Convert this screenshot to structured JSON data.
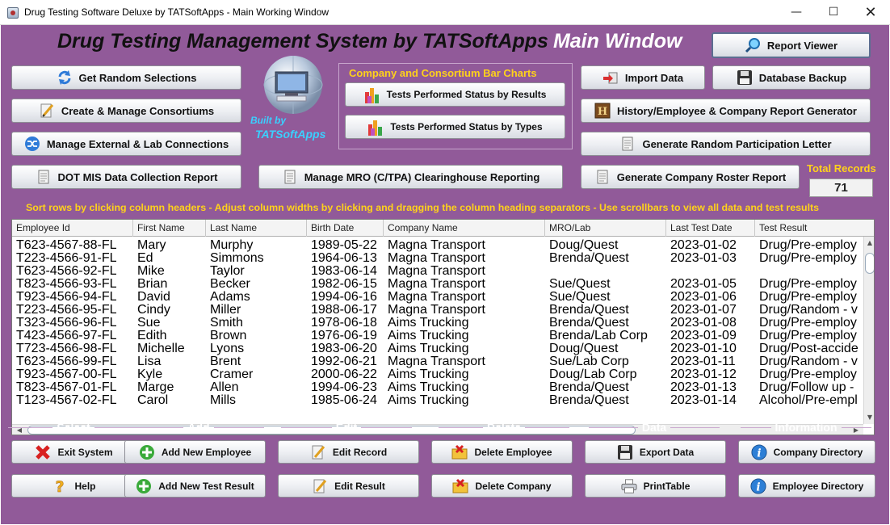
{
  "window": {
    "title": "Drug Testing Software Deluxe by TATSoftApps - Main Working Window",
    "minimize_glyph": "—",
    "maximize_glyph": "☐",
    "close_glyph": "✕"
  },
  "header": {
    "title": "Drug Testing Management System by TATSoftApps",
    "subtitle": "Main Window"
  },
  "branding": {
    "built_by": "Built by",
    "company": "TATSoftApps"
  },
  "buttons": {
    "report_viewer": "Report Viewer",
    "get_random_selections": "Get Random Selections",
    "create_manage_consortiums": "Create & Manage Consortiums",
    "manage_external_lab": "Manage External & Lab Connections",
    "dot_mis_report": "DOT MIS Data Collection Report",
    "manage_mro": "Manage MRO (C/TPA) Clearinghouse Reporting",
    "import_data": "Import Data",
    "database_backup": "Database Backup",
    "history_report": "History/Employee & Company Report Generator",
    "random_letter": "Generate Random Participation Letter",
    "company_roster": "Generate Company Roster Report"
  },
  "bar_charts": {
    "title": "Company and Consortium Bar Charts",
    "by_results": "Tests Performed Status by Results",
    "by_types": "Tests Performed Status by Types"
  },
  "total_records": {
    "label": "Total Records",
    "value": "71"
  },
  "instructions": "Sort rows by clicking column headers - Adjust column widths by clicking and dragging the column heading separators - Use scrollbars to view all data and test results",
  "table": {
    "columns": [
      "Employee Id",
      "First Name",
      "Last Name",
      "Birth Date",
      "Company Name",
      "MRO/Lab",
      "Last Test Date",
      "Test Result"
    ],
    "rows": [
      [
        "T623-4567-88-FL",
        "Mary",
        "Murphy",
        "1989-05-22",
        "Magna Transport",
        "Doug/Quest",
        "2023-01-02",
        "Drug/Pre-employ"
      ],
      [
        "T223-4566-91-FL",
        "Ed",
        "Simmons",
        "1964-06-13",
        "Magna Transport",
        "Brenda/Quest",
        "2023-01-03",
        "Drug/Pre-employ"
      ],
      [
        "T623-4566-92-FL",
        "Mike",
        "Taylor",
        "1983-06-14",
        "Magna Transport",
        "",
        "",
        ""
      ],
      [
        "T823-4566-93-FL",
        "Brian",
        "Becker",
        "1982-06-15",
        "Magna Transport",
        "Sue/Quest",
        "2023-01-05",
        "Drug/Pre-employ"
      ],
      [
        "T923-4566-94-FL",
        "David",
        "Adams",
        "1994-06-16",
        "Magna Transport",
        "Sue/Quest",
        "2023-01-06",
        "Drug/Pre-employ"
      ],
      [
        "T223-4566-95-FL",
        "Cindy",
        "Miller",
        "1988-06-17",
        "Magna Transport",
        "Brenda/Quest",
        "2023-01-07",
        "Drug/Random - v"
      ],
      [
        "T323-4566-96-FL",
        "Sue",
        "Smith",
        "1978-06-18",
        "Aims Trucking",
        "Brenda/Quest",
        "2023-01-08",
        "Drug/Pre-employ"
      ],
      [
        "T423-4566-97-FL",
        "Edith",
        "Brown",
        "1976-06-19",
        "Aims Trucking",
        "Brenda/Lab Corp",
        "2023-01-09",
        "Drug/Pre-employ"
      ],
      [
        "T723-4566-98-FL",
        "Michelle",
        "Lyons",
        "1983-06-20",
        "Aims Trucking",
        "Doug/Quest",
        "2023-01-10",
        "Drug/Post-accide"
      ],
      [
        "T623-4566-99-FL",
        "Lisa",
        "Brent",
        "1992-06-21",
        "Magna Transport",
        "Sue/Lab Corp",
        "2023-01-11",
        "Drug/Random - v"
      ],
      [
        "T923-4567-00-FL",
        "Kyle",
        "Cramer",
        "2000-06-22",
        "Aims Trucking",
        "Doug/Lab Corp",
        "2023-01-12",
        "Drug/Pre-employ"
      ],
      [
        "T823-4567-01-FL",
        "Marge",
        "Allen",
        "1994-06-23",
        "Aims Trucking",
        "Brenda/Quest",
        "2023-01-13",
        "Drug/Follow up -"
      ],
      [
        "T123-4567-02-FL",
        "Carol",
        "Mills",
        "1985-06-24",
        "Aims Trucking",
        "Brenda/Quest",
        "2023-01-14",
        "Alcohol/Pre-empl"
      ]
    ]
  },
  "sections": {
    "select": {
      "title": "Select",
      "buttons": [
        "Exit System",
        "Help"
      ]
    },
    "add": {
      "title": "Add",
      "buttons": [
        "Add New Employee",
        "Add New Test Result"
      ]
    },
    "edit": {
      "title": "Edit",
      "buttons": [
        "Edit Record",
        "Edit Result"
      ]
    },
    "delete": {
      "title": "Delete",
      "buttons": [
        "Delete Employee",
        "Delete Company"
      ]
    },
    "data": {
      "title": "Data",
      "buttons": [
        "Export Data",
        "PrintTable"
      ]
    },
    "information": {
      "title": "Information",
      "buttons": [
        "Company Directory",
        "Employee Directory"
      ]
    }
  },
  "colors": {
    "background": "#915a99",
    "accent_yellow": "#ffd21a",
    "builtby_cyan": "#3ad0ff"
  },
  "icons": [
    "search-icon",
    "refresh-icon",
    "pencil-icon",
    "shuffle-icon",
    "document-icon",
    "import-icon",
    "floppy-disk-icon",
    "history-icon",
    "bar-chart-icon",
    "exit-x-icon",
    "help-icon",
    "add-icon",
    "edit-icon",
    "delete-icon",
    "save-icon",
    "printer-icon",
    "info-icon"
  ]
}
